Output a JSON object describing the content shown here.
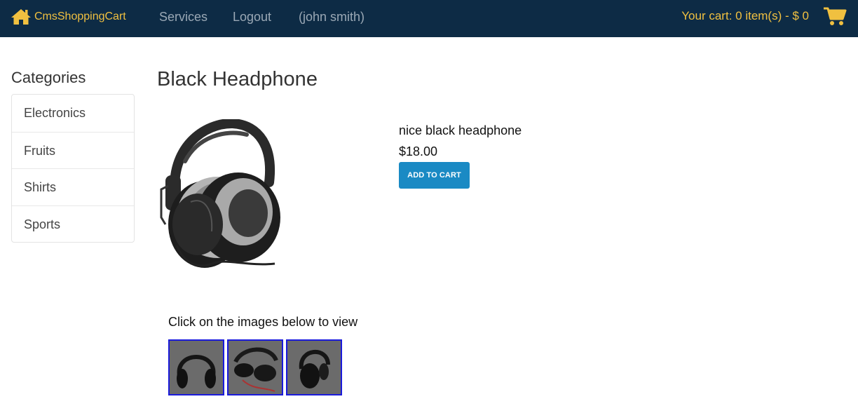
{
  "nav": {
    "brand": "CmsShoppingCart",
    "brand_icon": "home-icon",
    "links": [
      "Services",
      "Logout"
    ],
    "user": "(john smith)",
    "cart_text": "Your cart: 0 item(s) - $ 0",
    "cart_icon": "shopping-cart-icon",
    "accent_color": "#f0c040",
    "bg_color": "#0d2b45"
  },
  "sidebar": {
    "title": "Categories",
    "items": [
      {
        "label": "Electronics"
      },
      {
        "label": "Fruits"
      },
      {
        "label": "Shirts"
      },
      {
        "label": "Sports"
      }
    ]
  },
  "product": {
    "title": "Black Headphone",
    "description": "nice black headphone",
    "price": "$18.00",
    "add_to_cart_label": "ADD TO CART",
    "button_color": "#1a8ac4"
  },
  "gallery": {
    "label": "Click on the images below to view",
    "thumbnails": [
      "headphone-front",
      "headphone-folded",
      "headphone-side"
    ]
  }
}
